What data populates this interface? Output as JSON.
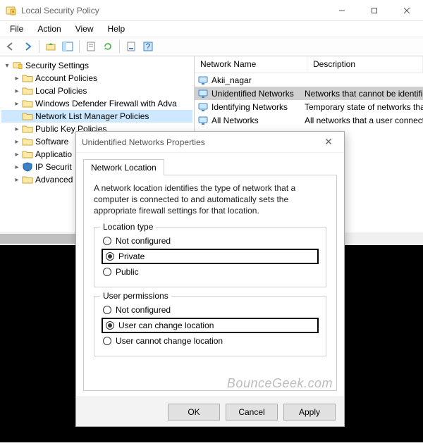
{
  "window": {
    "title": "Local Security Policy"
  },
  "menu": {
    "file": "File",
    "action": "Action",
    "view": "View",
    "help": "Help"
  },
  "tree": {
    "root": "Security Settings",
    "items": [
      "Account Policies",
      "Local Policies",
      "Windows Defender Firewall with Adva",
      "Network List Manager Policies",
      "Public Key Policies",
      "Software",
      "Applicatio",
      "IP Securit",
      "Advanced"
    ],
    "selected_index": 3
  },
  "list": {
    "col_name": "Network Name",
    "col_desc": "Description",
    "rows": [
      {
        "name": "Akii_nagar",
        "desc": ""
      },
      {
        "name": "Unidentified Networks",
        "desc": "Networks that cannot be identified"
      },
      {
        "name": "Identifying Networks",
        "desc": "Temporary state of networks that ar"
      },
      {
        "name": "All Networks",
        "desc": "All networks that a user connects to"
      }
    ],
    "selected_index": 1
  },
  "dialog": {
    "title": "Unidentified Networks Properties",
    "tab": "Network Location",
    "description": "A network location identifies the type of network that a computer is connected to and automatically sets the appropriate firewall settings for that location.",
    "group_location": {
      "legend": "Location type",
      "opt_not_configured": "Not configured",
      "opt_private": "Private",
      "opt_public": "Public",
      "selected": "opt_private"
    },
    "group_permissions": {
      "legend": "User permissions",
      "opt_not_configured": "Not configured",
      "opt_can_change": "User can change location",
      "opt_cannot_change": "User cannot change location",
      "selected": "opt_can_change"
    },
    "buttons": {
      "ok": "OK",
      "cancel": "Cancel",
      "apply": "Apply"
    }
  },
  "watermark": "BounceGeek.com"
}
